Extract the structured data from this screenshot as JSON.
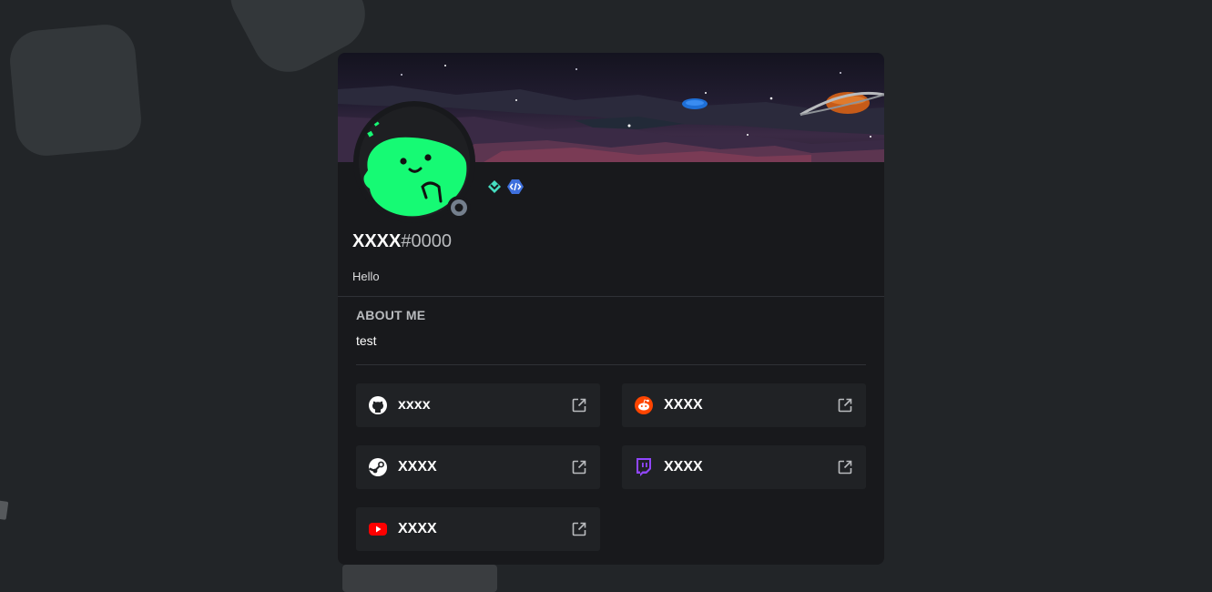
{
  "profile": {
    "name": "XXXX",
    "tag": "#0000",
    "status": "Hello",
    "badges": [
      "hypesquad-balance-badge",
      "verified-developer-badge"
    ]
  },
  "about": {
    "title": "ABOUT ME",
    "text": "test"
  },
  "connections": [
    {
      "service": "github",
      "icon": "github-icon",
      "label": "xxxx"
    },
    {
      "service": "reddit",
      "icon": "reddit-icon",
      "label": "XXXX"
    },
    {
      "service": "steam",
      "icon": "steam-icon",
      "label": "XXXX"
    },
    {
      "service": "twitch",
      "icon": "twitch-icon",
      "label": "XXXX"
    },
    {
      "service": "youtube",
      "icon": "youtube-icon",
      "label": "XXXX"
    }
  ],
  "colors": {
    "card": "#18191c",
    "connection_bg": "#202225",
    "avatar_green": "#16fa74",
    "status_offline": "#747f8d"
  }
}
